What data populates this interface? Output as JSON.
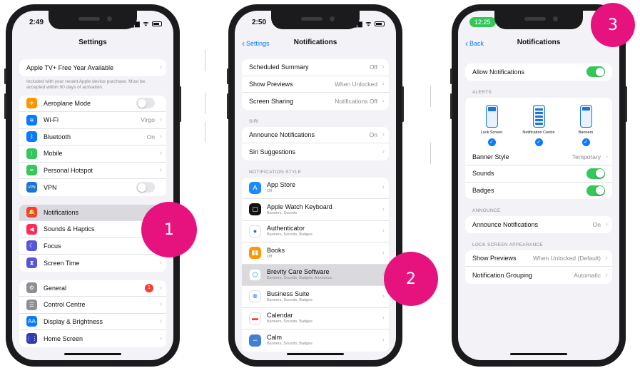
{
  "colors": {
    "accent": "#0a7aff",
    "toggle_on": "#34c759",
    "badge": "#e6137f"
  },
  "step_badges": [
    "1",
    "2",
    "3"
  ],
  "phone1": {
    "time": "2:49",
    "title": "Settings",
    "appletv": {
      "label": "Apple TV+ Free Year Available",
      "note": "Included with your recent Apple device purchase. Must be accepted within 90 days of activation."
    },
    "connectivity": [
      {
        "label": "Aeroplane Mode",
        "value": "",
        "icon": "airplane-icon",
        "color": "#ff9500",
        "glyph": "✈"
      },
      {
        "label": "Wi-Fi",
        "value": "Virgo",
        "icon": "wifi-icon",
        "color": "#0a7aff",
        "glyph": "≋"
      },
      {
        "label": "Bluetooth",
        "value": "On",
        "icon": "bluetooth-icon",
        "color": "#0a7aff",
        "glyph": "ᛒ"
      },
      {
        "label": "Mobile",
        "value": "",
        "icon": "antenna-icon",
        "color": "#34c759",
        "glyph": "⁝"
      },
      {
        "label": "Personal Hotspot",
        "value": "",
        "icon": "hotspot-icon",
        "color": "#34c759",
        "glyph": "∞"
      },
      {
        "label": "VPN",
        "value": "",
        "icon": "vpn-icon",
        "color": "#1a75d8",
        "glyph": "VPN"
      }
    ],
    "notifications_group": [
      {
        "label": "Notifications",
        "icon": "bell-icon",
        "color": "#ff3b30",
        "glyph": "🔔"
      },
      {
        "label": "Sounds & Haptics",
        "icon": "speaker-icon",
        "color": "#ff2d55",
        "glyph": "◀"
      },
      {
        "label": "Focus",
        "icon": "moon-icon",
        "color": "#5856d6",
        "glyph": "☾"
      },
      {
        "label": "Screen Time",
        "icon": "hourglass-icon",
        "color": "#5856d6",
        "glyph": "⧗"
      }
    ],
    "general_group": [
      {
        "label": "General",
        "badge": "1",
        "icon": "gear-icon",
        "color": "#8e8e93",
        "glyph": "⚙"
      },
      {
        "label": "Control Centre",
        "icon": "sliders-icon",
        "color": "#8e8e93",
        "glyph": "☰"
      },
      {
        "label": "Display & Brightness",
        "icon": "text-size-icon",
        "color": "#0a7aff",
        "glyph": "AA"
      },
      {
        "label": "Home Screen",
        "icon": "grid-icon",
        "color": "#2f3bb8",
        "glyph": "⋮⋮"
      }
    ]
  },
  "phone2": {
    "time": "2:50",
    "back": "Settings",
    "title": "Notifications",
    "top_group": [
      {
        "label": "Scheduled Summary",
        "value": "Off"
      },
      {
        "label": "Show Previews",
        "value": "When Unlocked"
      },
      {
        "label": "Screen Sharing",
        "value": "Notifications Off"
      }
    ],
    "siri_header": "SIRI",
    "siri_group": [
      {
        "label": "Announce Notifications",
        "value": "On"
      },
      {
        "label": "Siri Suggestions",
        "value": ""
      }
    ],
    "style_header": "NOTIFICATION STYLE",
    "apps": [
      {
        "name": "App Store",
        "sub": "Off",
        "icon": "app-store-icon",
        "color": "#1a8cff",
        "glyph": "A"
      },
      {
        "name": "Apple Watch Keyboard",
        "sub": "Banners, Sounds",
        "icon": "watch-keyboard-icon",
        "color": "#111111",
        "glyph": "▢"
      },
      {
        "name": "Authenticator",
        "sub": "Banners, Sounds, Badges",
        "icon": "authenticator-icon",
        "color": "#ffffff",
        "glyph": "●"
      },
      {
        "name": "Books",
        "sub": "Off",
        "icon": "books-icon",
        "color": "#ff9500",
        "glyph": "▮▮"
      },
      {
        "name": "Brevity Care Software",
        "sub": "Banners, Sounds, Badges, Announce",
        "icon": "brevity-icon",
        "color": "#ffffff",
        "glyph": "⬡"
      },
      {
        "name": "Business Suite",
        "sub": "Banners, Sounds, Badges",
        "icon": "business-suite-icon",
        "color": "#ffffff",
        "glyph": "⊗"
      },
      {
        "name": "Calendar",
        "sub": "Banners, Sounds, Badges",
        "icon": "calendar-icon",
        "color": "#ffffff",
        "glyph": "▬"
      },
      {
        "name": "Calm",
        "sub": "Banners, Sounds, Badges",
        "icon": "calm-icon",
        "color": "#3f7fd6",
        "glyph": "∽"
      }
    ]
  },
  "phone3": {
    "time": "12:25",
    "back": "Back",
    "title": "Notifications",
    "allow_label": "Allow Notifications",
    "alerts_header": "ALERTS",
    "alert_styles": [
      "Lock Screen",
      "Notification Centre",
      "Banners"
    ],
    "check": "✓",
    "alert_rows": [
      {
        "label": "Banner Style",
        "value": "Temporary",
        "type": "chevron"
      },
      {
        "label": "Sounds",
        "value": "",
        "type": "toggle"
      },
      {
        "label": "Badges",
        "value": "",
        "type": "toggle"
      }
    ],
    "announce_header": "ANNOUNCE",
    "announce_row": {
      "label": "Announce Notifications",
      "value": "On"
    },
    "lock_header": "LOCK SCREEN APPEARANCE",
    "lock_rows": [
      {
        "label": "Show Previews",
        "value": "When Unlocked (Default)"
      },
      {
        "label": "Notification Grouping",
        "value": "Automatic"
      }
    ]
  },
  "chevron": "›"
}
